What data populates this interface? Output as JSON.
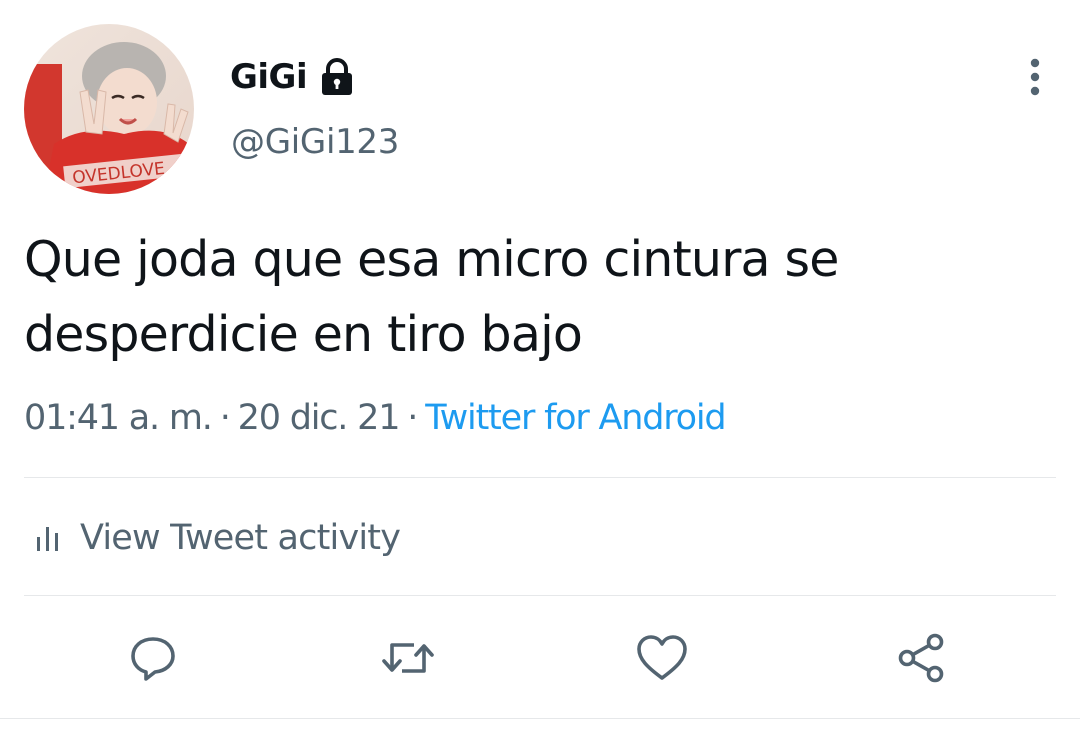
{
  "tweet": {
    "author": {
      "display_name": "GiGi",
      "handle": "@GiGi123",
      "protected_icon": "lock-icon",
      "avatar_shirt_text": "OVEDLOVE"
    },
    "text_line1": "Que joda que esa micro cintura se",
    "text_line2": "desperdicie en tiro bajo",
    "time": "01:41 a. m.",
    "date": "20 dic. 21",
    "separator": "·",
    "source": "Twitter for Android"
  },
  "activity": {
    "label": "View Tweet activity",
    "icon": "bar-chart-icon"
  },
  "actions": [
    {
      "name": "reply",
      "icon": "reply-icon"
    },
    {
      "name": "retweet",
      "icon": "retweet-icon"
    },
    {
      "name": "like",
      "icon": "heart-icon"
    },
    {
      "name": "share",
      "icon": "share-icon"
    }
  ],
  "colors": {
    "primary_text": "#0f1419",
    "secondary_text": "#536471",
    "link": "#1d9bf0",
    "divider": "#e6e8ea",
    "icon": "#536471"
  }
}
